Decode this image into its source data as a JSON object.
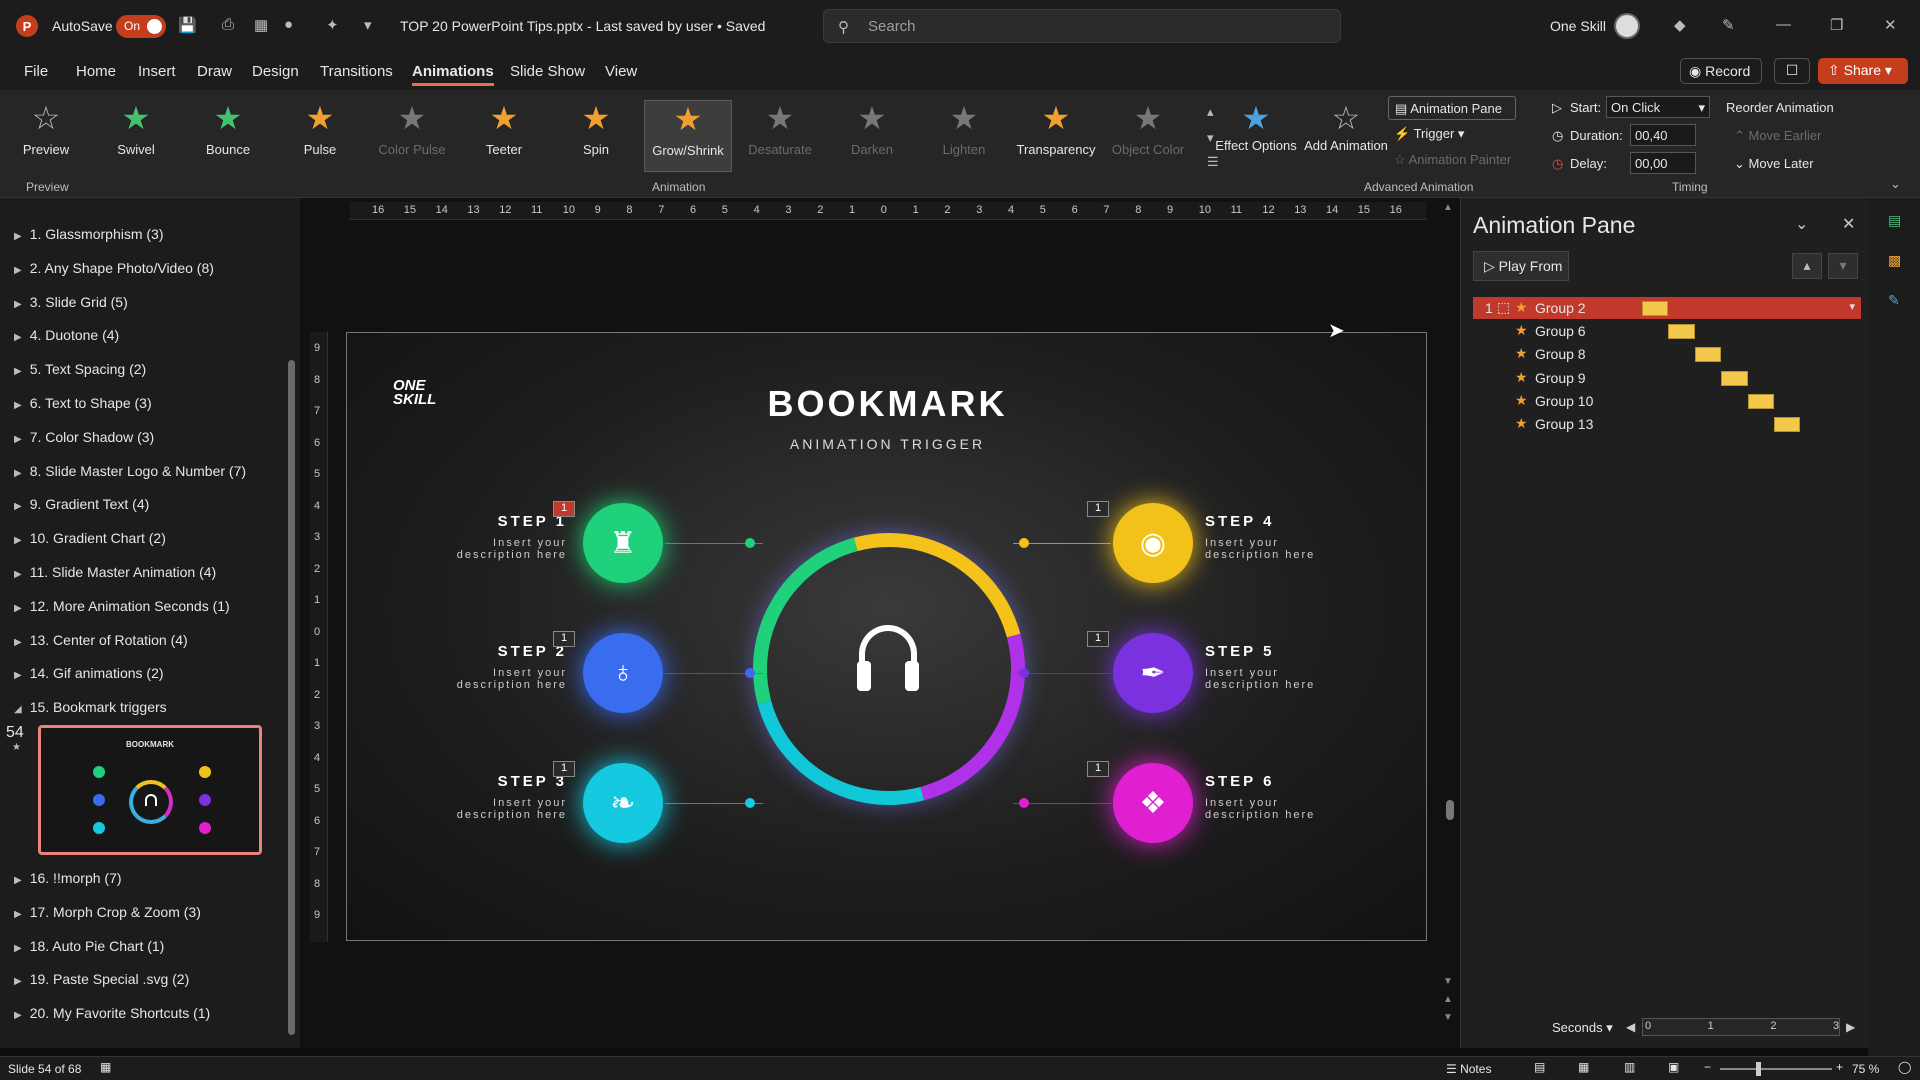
{
  "titlebar": {
    "autosave_label": "AutoSave",
    "autosave_state": "On",
    "doc_title": "TOP 20 PowerPoint Tips.pptx  -  Last saved by user  •  Saved",
    "search_placeholder": "Search",
    "user_name": "One Skill"
  },
  "menu": [
    "File",
    "Home",
    "Insert",
    "Draw",
    "Design",
    "Transitions",
    "Animations",
    "Slide Show",
    "View"
  ],
  "menu_active": "Animations",
  "header_buttons": {
    "record": "Record",
    "share": "Share"
  },
  "ribbon": {
    "preview": "Preview",
    "effects": [
      {
        "label": "Swivel",
        "color": "#43c26b",
        "enabled": true
      },
      {
        "label": "Bounce",
        "color": "#43c26b",
        "enabled": true
      },
      {
        "label": "Pulse",
        "color": "#f0a030",
        "enabled": true
      },
      {
        "label": "Color Pulse",
        "color": "#777777",
        "enabled": false
      },
      {
        "label": "Teeter",
        "color": "#f0a030",
        "enabled": true
      },
      {
        "label": "Spin",
        "color": "#f0a030",
        "enabled": true
      },
      {
        "label": "Grow/Shrink",
        "color": "#f0a030",
        "enabled": true,
        "selected": true
      },
      {
        "label": "Desaturate",
        "color": "#777777",
        "enabled": false
      },
      {
        "label": "Darken",
        "color": "#777777",
        "enabled": false
      },
      {
        "label": "Lighten",
        "color": "#777777",
        "enabled": false
      },
      {
        "label": "Transparency",
        "color": "#f0a030",
        "enabled": true
      },
      {
        "label": "Object Color",
        "color": "#777777",
        "enabled": false
      }
    ],
    "effect_options": "Effect Options",
    "add_animation": "Add Animation",
    "animation_pane": "Animation Pane",
    "trigger": "Trigger",
    "animation_painter": "Animation Painter",
    "start_label": "Start:",
    "start_value": "On Click",
    "duration_label": "Duration:",
    "duration_value": "00,40",
    "delay_label": "Delay:",
    "delay_value": "00,00",
    "reorder": "Reorder Animation",
    "move_earlier": "Move Earlier",
    "move_later": "Move Later",
    "groups": {
      "preview": "Preview",
      "animation": "Animation",
      "advanced": "Advanced Animation",
      "timing": "Timing"
    }
  },
  "sections": [
    "1. Glassmorphism (3)",
    "2. Any Shape Photo/Video (8)",
    "3. Slide Grid (5)",
    "4. Duotone (4)",
    "5. Text Spacing (2)",
    "6. Text to Shape (3)",
    "7. Color Shadow (3)",
    "8. Slide Master Logo & Number (7)",
    "9. Gradient Text (4)",
    "10. Gradient Chart (2)",
    "11. Slide Master Animation (4)",
    "12. More Animation Seconds (1)",
    "13. Center of Rotation (4)",
    "14. Gif animations (2)",
    "15. Bookmark triggers"
  ],
  "sections_after": [
    "16. !!morph (7)",
    "17. Morph Crop & Zoom (3)",
    "18. Auto Pie Chart (1)",
    "19. Paste Special .svg (2)",
    "20. My Favorite Shortcuts (1)"
  ],
  "slide_number": "54",
  "thumb_title": "BOOKMARK",
  "ruler_h": [
    "16",
    "15",
    "14",
    "13",
    "12",
    "11",
    "10",
    "9",
    "8",
    "7",
    "6",
    "5",
    "4",
    "3",
    "2",
    "1",
    "0",
    "1",
    "2",
    "3",
    "4",
    "5",
    "6",
    "7",
    "8",
    "9",
    "10",
    "11",
    "12",
    "13",
    "14",
    "15",
    "16"
  ],
  "ruler_v": [
    "9",
    "8",
    "7",
    "6",
    "5",
    "4",
    "3",
    "2",
    "1",
    "0",
    "1",
    "2",
    "3",
    "4",
    "5",
    "6",
    "7",
    "8",
    "9"
  ],
  "slide": {
    "logo_top": "ONE",
    "logo_bottom": "SKILL",
    "title": "BOOKMARK",
    "subtitle": "ANIMATION TRIGGER",
    "desc": "Insert your description here",
    "steps": [
      {
        "label": "STEP 1",
        "badge": "1",
        "color": "#1fd17a",
        "icon": "chess-icon"
      },
      {
        "label": "STEP 2",
        "badge": "1",
        "color": "#3a6cf0",
        "icon": "planet-icon"
      },
      {
        "label": "STEP 3",
        "badge": "1",
        "color": "#14c9e0",
        "icon": "cat-icon"
      },
      {
        "label": "STEP 4",
        "badge": "1",
        "color": "#f2c21a",
        "icon": "camera-icon"
      },
      {
        "label": "STEP 5",
        "badge": "1",
        "color": "#7a32e0",
        "icon": "pen-icon"
      },
      {
        "label": "STEP 6",
        "badge": "1",
        "color": "#e020d0",
        "icon": "gamepad-icon"
      }
    ]
  },
  "pane": {
    "title": "Animation Pane",
    "play_from": "Play From",
    "items": [
      {
        "index": "1",
        "name": "Group 2",
        "start": 0.0,
        "selected": true
      },
      {
        "index": "",
        "name": "Group 6",
        "start": 0.4
      },
      {
        "index": "",
        "name": "Group 8",
        "start": 0.8
      },
      {
        "index": "",
        "name": "Group 9",
        "start": 1.2
      },
      {
        "index": "",
        "name": "Group 10",
        "start": 1.6
      },
      {
        "index": "",
        "name": "Group 13",
        "start": 2.0
      }
    ],
    "item_duration": 0.4,
    "timeline_max": 3,
    "seconds_label": "Seconds",
    "timeline_ticks": [
      "0",
      "1",
      "2",
      "3"
    ]
  },
  "status": {
    "slide_info": "Slide 54 of 68",
    "notes": "Notes",
    "zoom": "75 %"
  }
}
